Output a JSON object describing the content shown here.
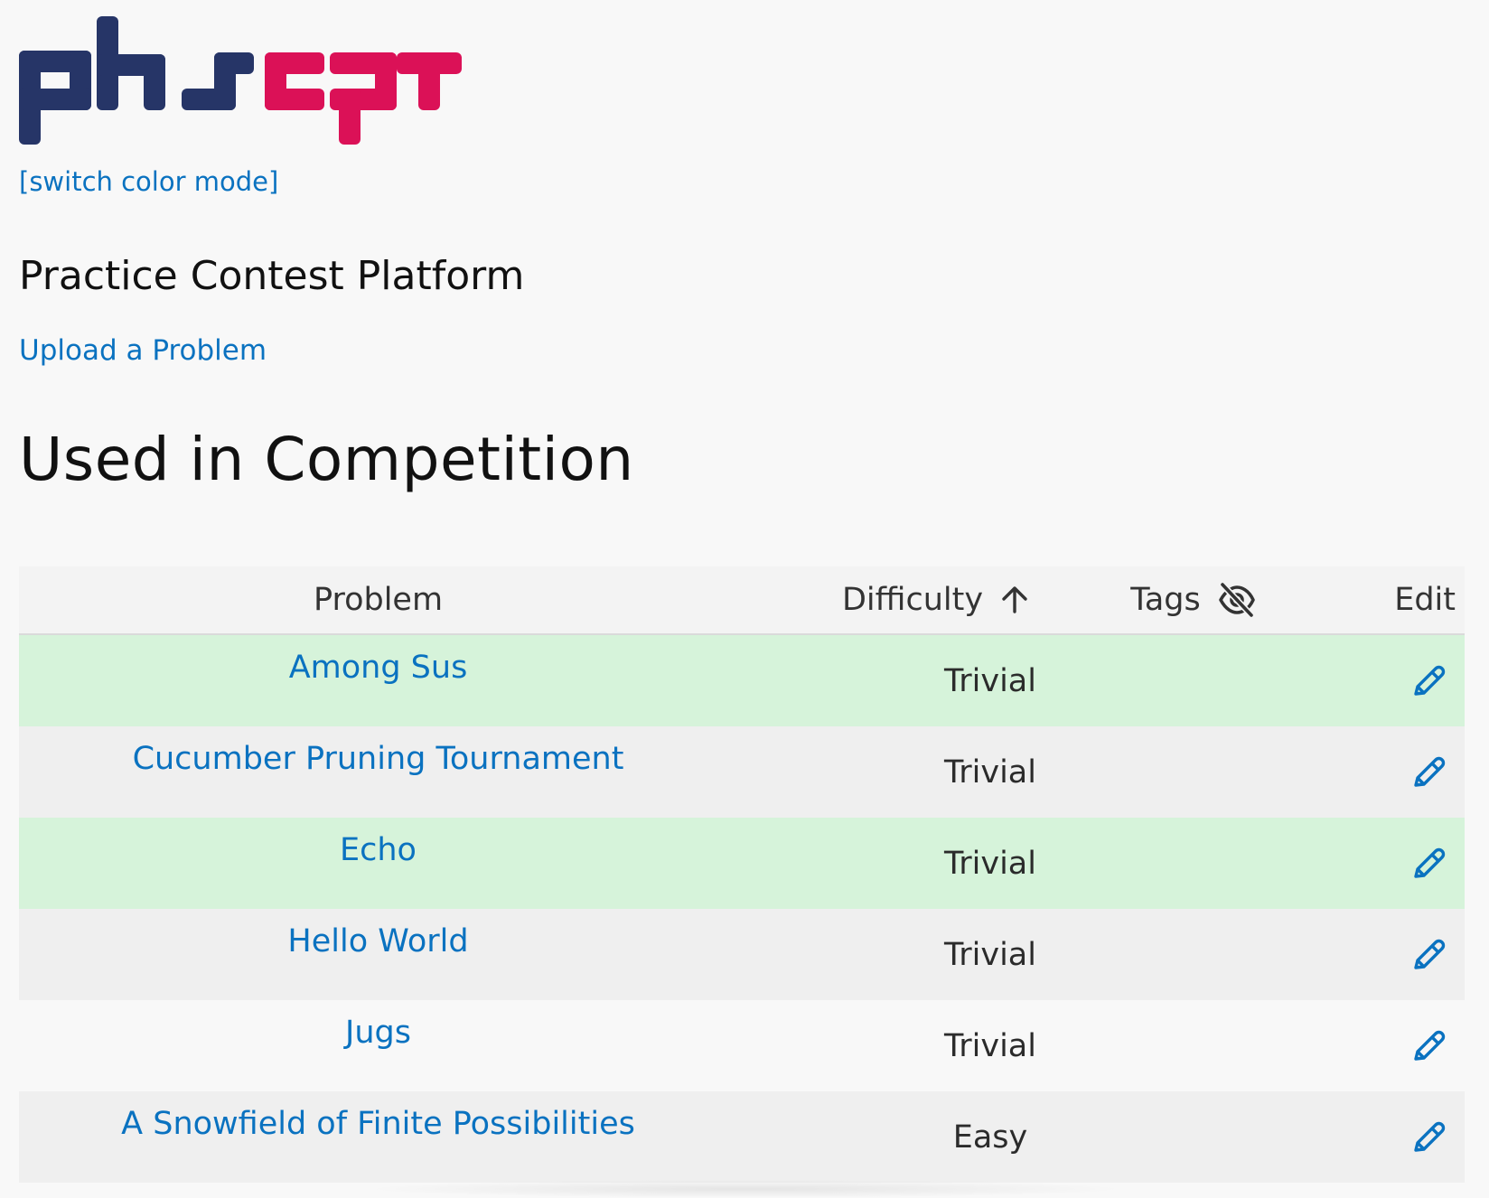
{
  "header": {
    "logo_text": "phscpt",
    "switch_color_mode": "[switch color mode]",
    "site_title": "Practice Contest Platform",
    "upload_link": "Upload a Problem"
  },
  "section": {
    "title": "Used in Competition"
  },
  "table": {
    "columns": {
      "problem": "Problem",
      "difficulty": "Difficulty",
      "tags": "Tags",
      "edit": "Edit"
    },
    "rows": [
      {
        "problem": "Among Sus",
        "difficulty": "Trivial",
        "solved": true
      },
      {
        "problem": "Cucumber Pruning Tournament",
        "difficulty": "Trivial",
        "solved": false
      },
      {
        "problem": "Echo",
        "difficulty": "Trivial",
        "solved": true
      },
      {
        "problem": "Hello World",
        "difficulty": "Trivial",
        "solved": false
      },
      {
        "problem": "Jugs",
        "difficulty": "Trivial",
        "solved": false
      },
      {
        "problem": "A Snowfield of Finite Possibilities",
        "difficulty": "Easy",
        "solved": false
      }
    ]
  },
  "icons": {
    "sort": "arrow-up-icon",
    "tags_toggle": "eye-off-icon",
    "edit": "pencil-icon"
  },
  "colors": {
    "logo_navy": "#263567",
    "logo_crimson": "#db1157",
    "link_blue": "#0a72c0",
    "solved_row": "#d6f3da",
    "striped_row": "#efefef",
    "background": "#f8f8f8"
  }
}
